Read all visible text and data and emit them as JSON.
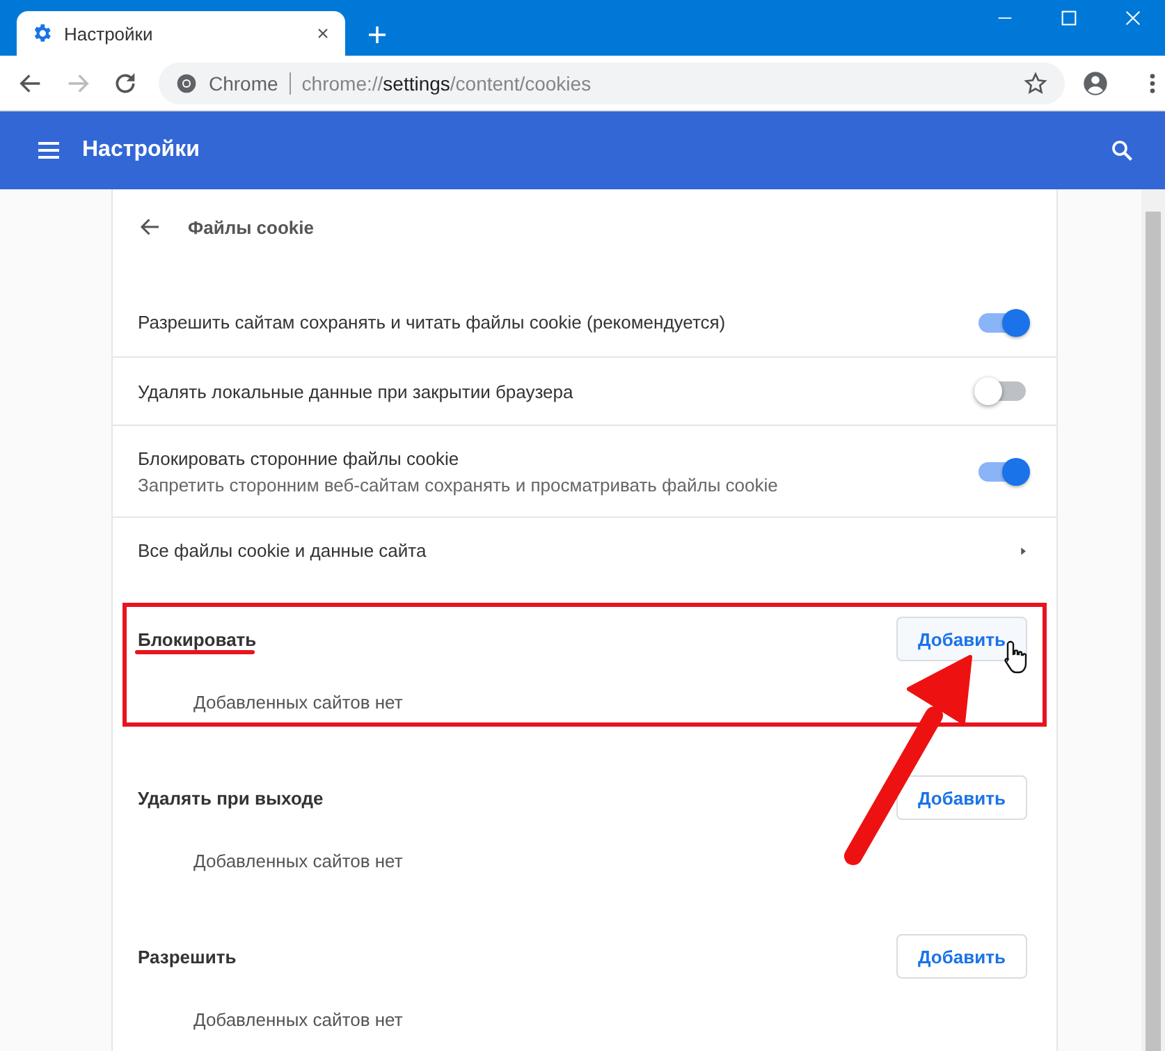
{
  "tab": {
    "title": "Настройки"
  },
  "nav_buttons": [
    {
      "kind": "back",
      "disabled": false
    },
    {
      "kind": "forward",
      "disabled": true
    },
    {
      "kind": "reload",
      "disabled": false
    }
  ],
  "omnibox": {
    "site_label": "Chrome",
    "url_scheme": "chrome://",
    "url_host": "settings",
    "url_path": "/content/cookies"
  },
  "header": {
    "title": "Настройки"
  },
  "page": {
    "title": "Файлы cookie",
    "toggles": [
      {
        "label": "Разрешить сайтам сохранять и читать файлы cookie (рекомендуется)",
        "on": true
      },
      {
        "label": "Удалять локальные данные при закрытии браузера",
        "on": false
      },
      {
        "label": "Блокировать сторонние файлы cookie",
        "sublabel": "Запретить сторонним веб-сайтам сохранять и просматривать файлы cookie",
        "on": true
      }
    ],
    "link_row": {
      "label": "Все файлы cookie и данные сайта"
    },
    "sections": [
      {
        "title": "Блокировать",
        "button": "Добавить",
        "empty_text": "Добавленных сайтов нет",
        "highlighted": true
      },
      {
        "title": "Удалять при выходе",
        "button": "Добавить",
        "empty_text": "Добавленных сайтов нет",
        "highlighted": false
      },
      {
        "title": "Разрешить",
        "button": "Добавить",
        "empty_text": "Добавленных сайтов нет",
        "highlighted": false
      }
    ]
  }
}
